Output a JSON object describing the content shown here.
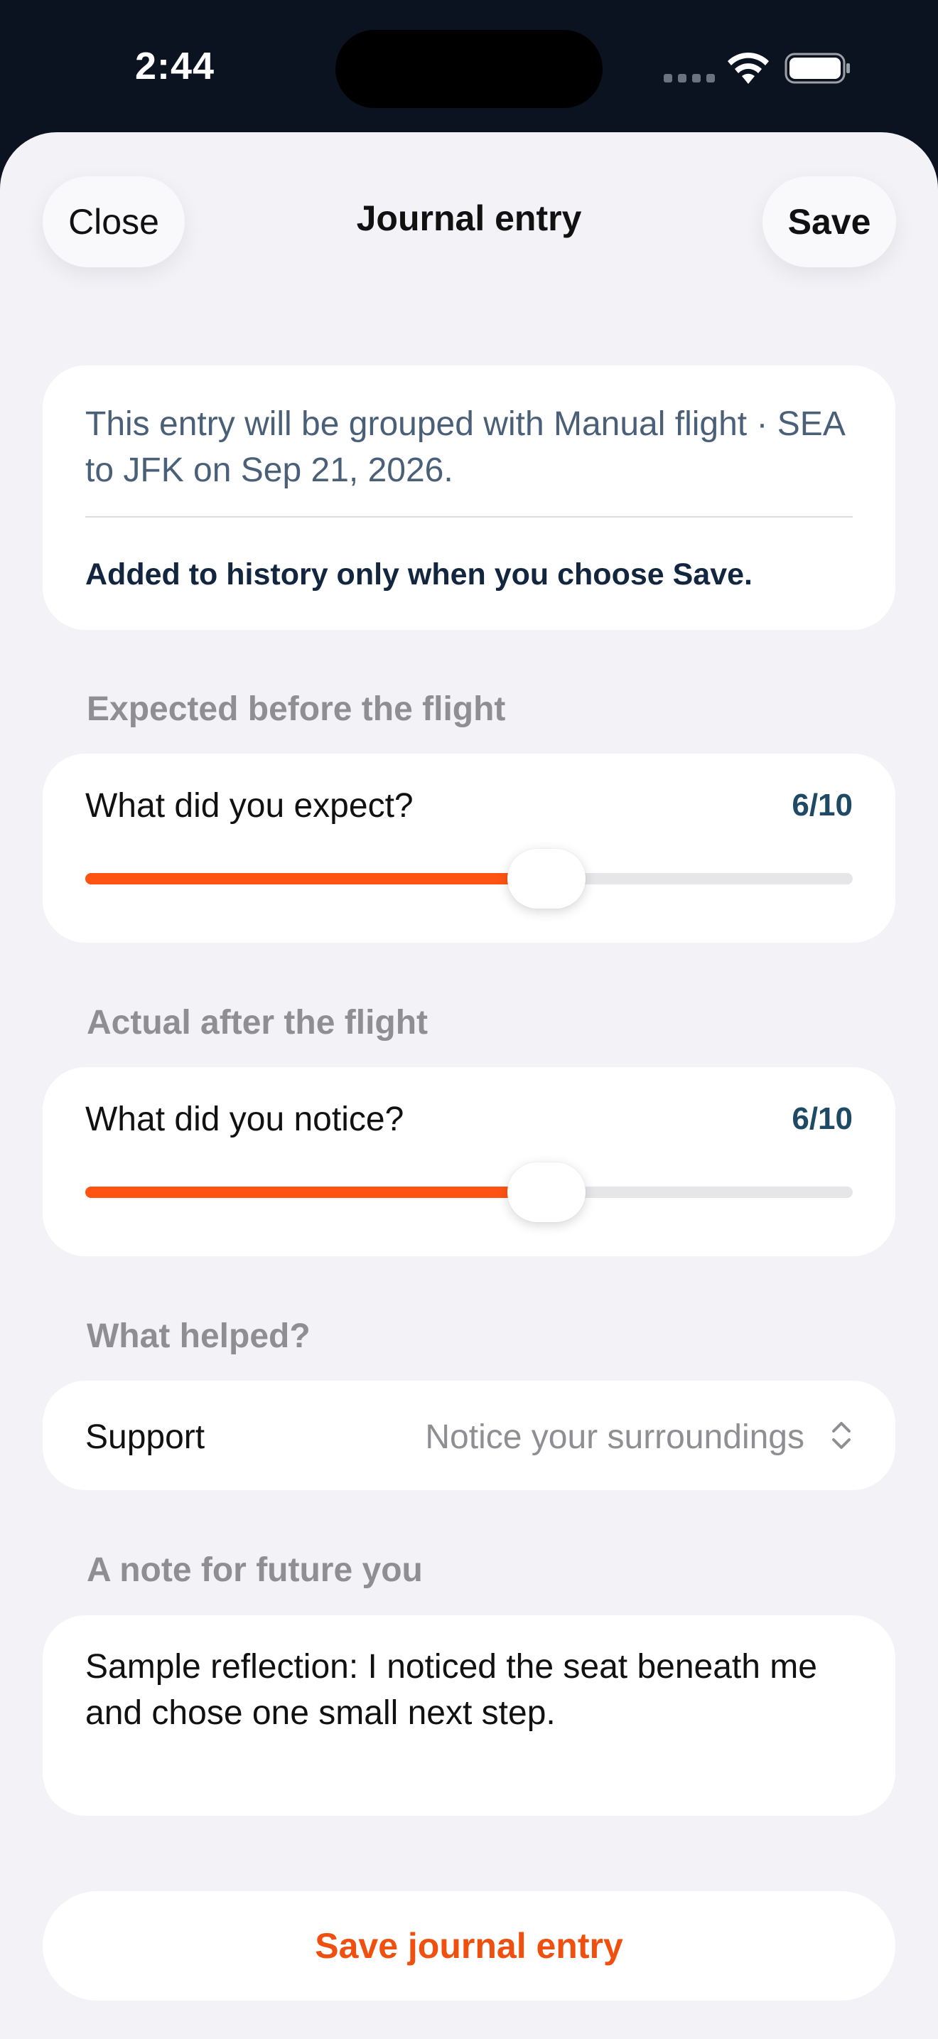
{
  "status_bar": {
    "time": "2:44"
  },
  "nav": {
    "close_label": "Close",
    "title": "Journal entry",
    "save_label": "Save"
  },
  "info": {
    "grouping_text": "This entry will be grouped with Manual flight · SEA to JFK on Sep 21, 2026.",
    "note": "Added to history only when you choose Save."
  },
  "expected": {
    "section_label": "Expected before the flight",
    "question": "What did you expect?",
    "value_text": "6/10",
    "value": 6,
    "max": 10
  },
  "actual": {
    "section_label": "Actual after the flight",
    "question": "What did you notice?",
    "value_text": "6/10",
    "value": 6,
    "max": 10
  },
  "helped": {
    "section_label": "What helped?",
    "field_label": "Support",
    "selected": "Notice your surroundings"
  },
  "note": {
    "section_label": "A note for future you",
    "text": "Sample reflection: I noticed the seat beneath me and chose one small next step."
  },
  "primary_button": {
    "label": "Save journal entry"
  },
  "colors": {
    "accent": "#ff5314",
    "value_text": "#1f4a66",
    "sheet_bg": "#f2f2f7"
  }
}
